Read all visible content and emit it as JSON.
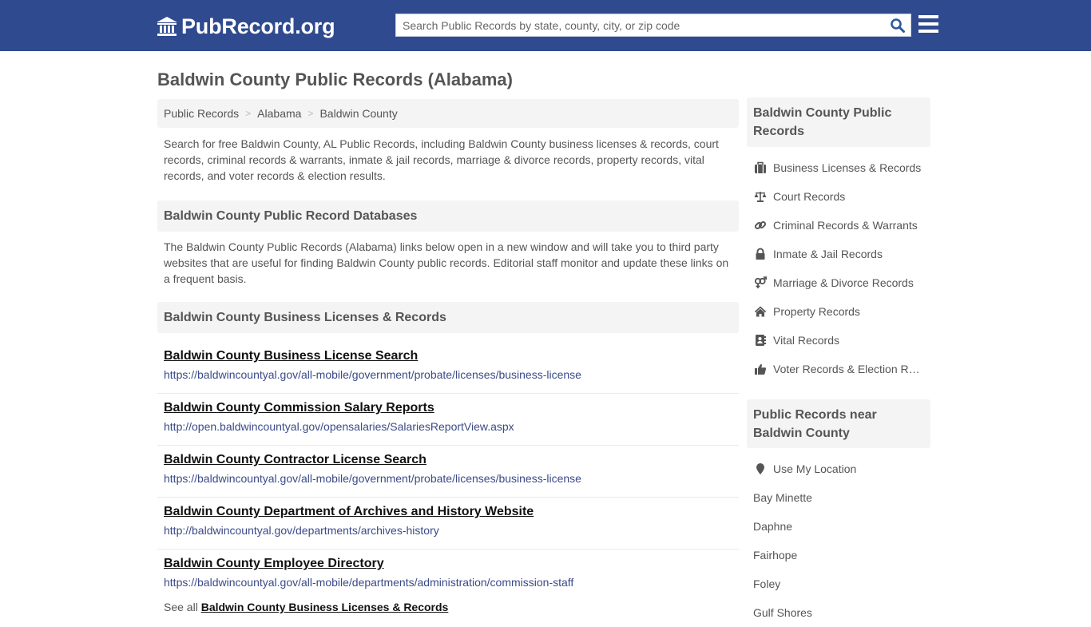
{
  "header": {
    "logo_text": "PubRecord.org",
    "search_placeholder": "Search Public Records by state, county, city, or zip code",
    "search_value": ""
  },
  "page": {
    "title": "Baldwin County Public Records (Alabama)",
    "breadcrumb": [
      {
        "label": "Public Records"
      },
      {
        "label": "Alabama"
      },
      {
        "label": "Baldwin County"
      }
    ],
    "breadcrumb_separator": ">",
    "intro": "Search for free Baldwin County, AL Public Records, including Baldwin County business licenses & records, court records, criminal records & warrants, inmate & jail records, marriage & divorce records, property records, vital records, and voter records & election results."
  },
  "databases": {
    "heading": "Baldwin County Public Record Databases",
    "description": "The Baldwin County Public Records (Alabama) links below open in a new window and will take you to third party websites that are useful for finding Baldwin County public records. Editorial staff monitor and update these links on a frequent basis."
  },
  "business_section": {
    "heading": "Baldwin County Business Licenses & Records",
    "links": [
      {
        "title": "Baldwin County Business License Search",
        "url": "https://baldwincountyal.gov/all-mobile/government/probate/licenses/business-license"
      },
      {
        "title": "Baldwin County Commission Salary Reports",
        "url": "http://open.baldwincountyal.gov/opensalaries/SalariesReportView.aspx"
      },
      {
        "title": "Baldwin County Contractor License Search",
        "url": "https://baldwincountyal.gov/all-mobile/government/probate/licenses/business-license"
      },
      {
        "title": "Baldwin County Department of Archives and History Website",
        "url": "http://baldwincountyal.gov/departments/archives-history"
      },
      {
        "title": "Baldwin County Employee Directory",
        "url": "https://baldwincountyal.gov/all-mobile/departments/administration/commission-staff"
      }
    ],
    "see_all_prefix": "See all",
    "see_all_link": "Baldwin County Business Licenses & Records"
  },
  "sidebar": {
    "records_heading": "Baldwin County Public Records",
    "records_items": [
      {
        "label": "Business Licenses & Records",
        "icon": "briefcase-icon"
      },
      {
        "label": "Court Records",
        "icon": "scale-icon"
      },
      {
        "label": "Criminal Records & Warrants",
        "icon": "link-icon"
      },
      {
        "label": "Inmate & Jail Records",
        "icon": "lock-icon"
      },
      {
        "label": "Marriage & Divorce Records",
        "icon": "venus-mars-icon"
      },
      {
        "label": "Property Records",
        "icon": "home-icon"
      },
      {
        "label": "Vital Records",
        "icon": "address-book-icon"
      },
      {
        "label": "Voter Records & Election Results",
        "icon": "thumbs-up-icon"
      }
    ],
    "nearby_heading": "Public Records near Baldwin County",
    "nearby_items": [
      {
        "label": "Use My Location",
        "icon": "map-marker-icon"
      },
      {
        "label": "Bay Minette"
      },
      {
        "label": "Daphne"
      },
      {
        "label": "Fairhope"
      },
      {
        "label": "Foley"
      },
      {
        "label": "Gulf Shores"
      }
    ]
  }
}
